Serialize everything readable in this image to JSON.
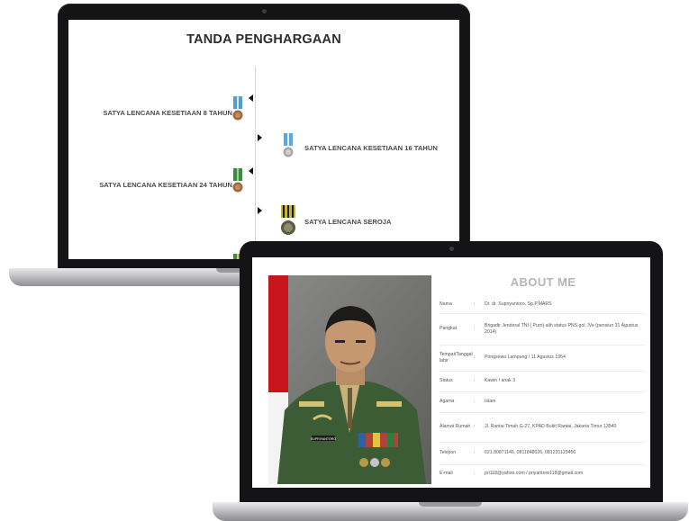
{
  "penghargaan": {
    "title": "TANDA PENGHARGAAN",
    "awards": [
      {
        "label": "SATYA LENCANA KESETIAAN 8 TAHUN",
        "side": "left"
      },
      {
        "label": "SATYA LENCANA KESETIAAN 16 TAHUN",
        "side": "right"
      },
      {
        "label": "SATYA LENCANA KESETIAAN 24 TAHUN",
        "side": "left"
      },
      {
        "label": "SATYA LENCANA SEROJA",
        "side": "right"
      }
    ]
  },
  "about": {
    "title": "ABOUT ME",
    "separator": ":",
    "name_tag": "SUPRIYANTORO",
    "rows": [
      {
        "label": "Nama",
        "value": "Dr. dr. Supriyantoro, Sp.P,MARS"
      },
      {
        "label": "Pangkat",
        "value": "Brigadir Jenderal TNI ( Purn) alih status PNS gol. IVe (pensiun 31 Agustus 2014)"
      },
      {
        "label": "Tempat/Tanggal lahir",
        "value": "Pringsewu Lampung / 11 Agustus 1954"
      },
      {
        "label": "Status",
        "value": "Kawin / anak 3"
      },
      {
        "label": "Agama",
        "value": "Islam"
      },
      {
        "label": "Alamat Rumah",
        "value": "Jl. Rantai Timah G-27, KPAD Bukit Rantai, Jakarta Timur 13540"
      },
      {
        "label": "Telepon",
        "value": "021.80871146, 0811848026, 081231123456"
      },
      {
        "label": "E-mail",
        "value": "pri118@yahoo.com / priyantoro118@gmail.com"
      }
    ]
  },
  "colors": {
    "laptop_bezel": "#141416",
    "ribbon_blue": "#4f9fd4",
    "ribbon_green": "#3e8a3e",
    "medal_bronze": "#a06a40",
    "medal_silver": "#a9a9a9",
    "uniform_green": "#3b5c34"
  }
}
